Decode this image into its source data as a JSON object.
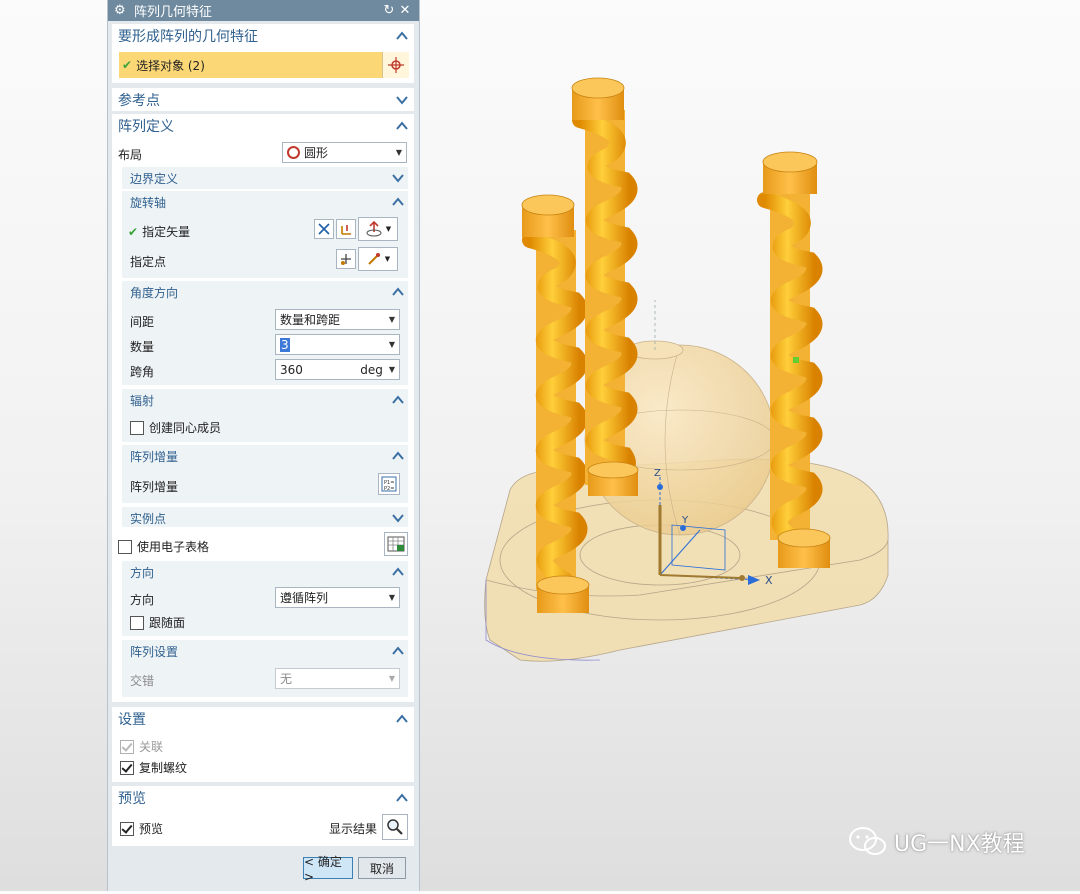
{
  "dialog": {
    "title": "阵列几何特征",
    "geometry_group": {
      "title": "要形成阵列的几何特征",
      "select_label": "选择对象 (2)"
    },
    "reference_group": {
      "title": "参考点"
    },
    "pattern_group": {
      "title": "阵列定义",
      "layout_label": "布局",
      "layout_value": "圆形",
      "boundary": {
        "title": "边界定义"
      },
      "rotation_axis": {
        "title": "旋转轴",
        "vector_label": "指定矢量",
        "point_label": "指定点"
      },
      "angular": {
        "title": "角度方向",
        "spacing_label": "间距",
        "spacing_value": "数量和跨距",
        "count_label": "数量",
        "count_value": "3",
        "span_label": "跨角",
        "span_value": "360",
        "span_unit": "deg"
      },
      "radial": {
        "title": "辐射",
        "concentric_label": "创建同心成员",
        "concentric_checked": false
      },
      "increment": {
        "title": "阵列增量",
        "label": "阵列增量"
      },
      "instance": {
        "title": "实例点"
      },
      "spreadsheet": {
        "label": "使用电子表格",
        "checked": false
      },
      "orientation": {
        "title": "方向",
        "label": "方向",
        "value": "遵循阵列",
        "follow_face_label": "跟随面",
        "follow_face_checked": false
      },
      "settings": {
        "title": "阵列设置",
        "stagger_label": "交错",
        "stagger_value": "无"
      }
    },
    "settings_group": {
      "title": "设置",
      "associative_label": "关联",
      "associative_checked": true,
      "copy_threads_label": "复制螺纹",
      "copy_threads_checked": true
    },
    "preview_group": {
      "title": "预览",
      "preview_label": "预览",
      "preview_checked": true,
      "show_result_label": "显示结果"
    },
    "ok_label": "< 确定 >",
    "cancel_label": "取消"
  },
  "viewport": {
    "axis_x": "X",
    "axis_y": "Y",
    "axis_z": "Z"
  },
  "watermark": "UG一NX教程",
  "colors": {
    "title_bar": "#6f8a9f",
    "section_text": "#30618f",
    "highlight_row": "#fbd776",
    "model_orange": "#f5a623"
  }
}
